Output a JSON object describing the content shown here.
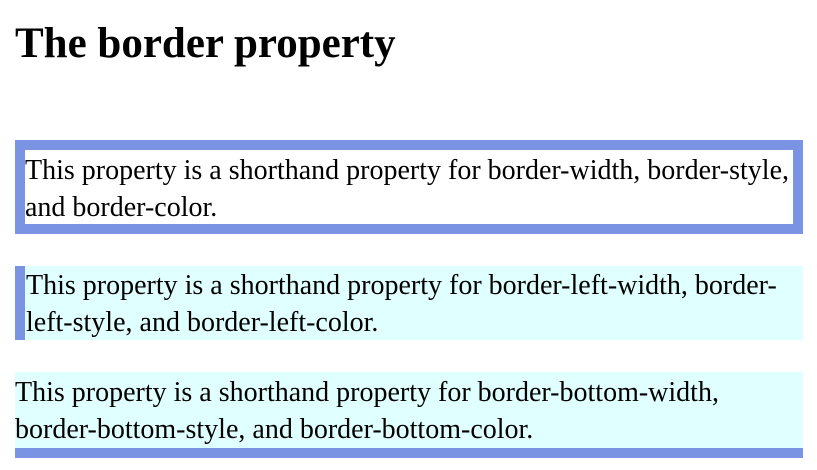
{
  "heading": "The border property",
  "paragraphs": {
    "border": "This property is a shorthand property for border-width, border-style, and border-color.",
    "border_left": "This property is a shorthand property for border-left-width, border-left-style, and border-left-color.",
    "border_bottom": "This property is a shorthand property for border-bottom-width, border-bottom-style, and border-bottom-color."
  },
  "colors": {
    "border": "#7b93e3",
    "highlight_background": "#e0ffff",
    "page_background": "#ffffff"
  }
}
